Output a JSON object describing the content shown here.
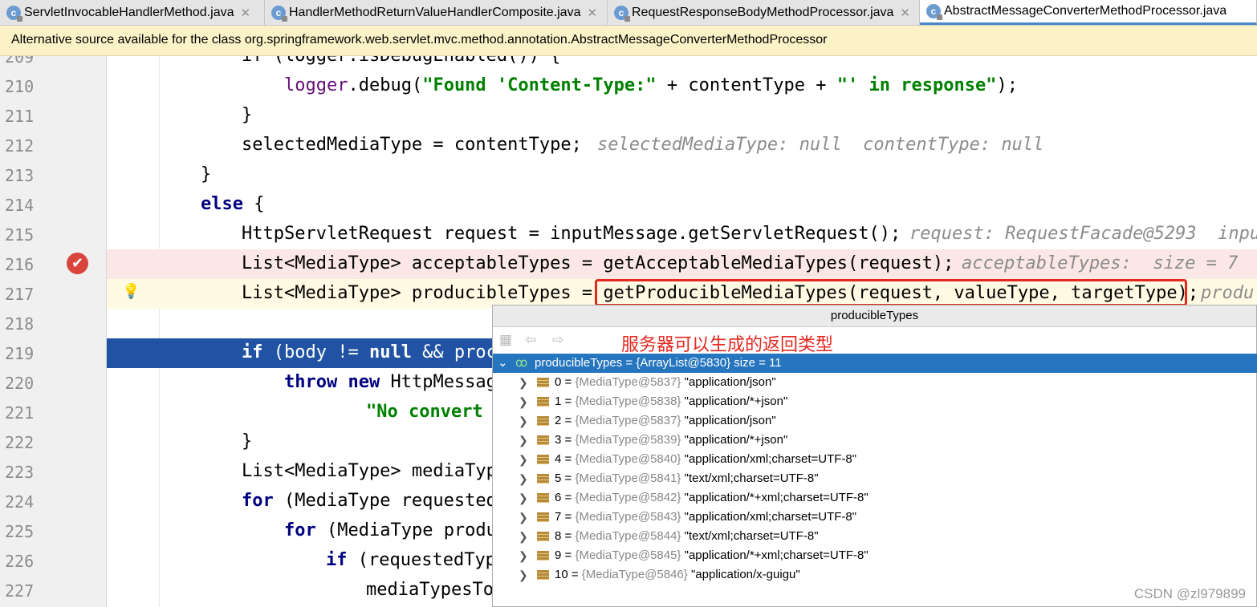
{
  "tabs": [
    {
      "label": "ServletInvocableHandlerMethod.java",
      "active": false
    },
    {
      "label": "HandlerMethodReturnValueHandlerComposite.java",
      "active": false
    },
    {
      "label": "RequestResponseBodyMethodProcessor.java",
      "active": false
    },
    {
      "label": "AbstractMessageConverterMethodProcessor.java",
      "active": true
    }
  ],
  "notice": "Alternative source available for the class org.springframework.web.servlet.mvc.method.annotation.AbstractMessageConverterMethodProcessor",
  "lines": {
    "l209": {
      "num": "209",
      "code": "if (logger.isDebugEnabled()) {"
    },
    "l210": {
      "num": "210",
      "call": "logger",
      "rest": ".debug(",
      "s1": "\"Found 'Content-Type:\"",
      "mid": " + contentType + ",
      "s2": "\"' in response\"",
      "end": ");"
    },
    "l211": {
      "num": "211",
      "code": "}"
    },
    "l212": {
      "num": "212",
      "code": "selectedMediaType = contentType;",
      "hint": "selectedMediaType: null  contentType: null"
    },
    "l213": {
      "num": "213",
      "code": "}"
    },
    "l214": {
      "num": "214",
      "kw": "else",
      "code": " {"
    },
    "l215": {
      "num": "215",
      "code": "HttpServletRequest request = inputMessage.getServletRequest();",
      "hint": "request: RequestFacade@5293  inpu"
    },
    "l216": {
      "num": "216",
      "code": "List<MediaType> acceptableTypes = getAcceptableMediaTypes(request);",
      "hint": "acceptableTypes:  size = 7"
    },
    "l217": {
      "num": "217",
      "code": "List<MediaType> producibleTypes = getProducibleMediaTypes(request, valueType, targetType);",
      "hint": "produ"
    },
    "l218": {
      "num": "218",
      "code": ""
    },
    "l219": {
      "num": "219",
      "kw": "if",
      "code": " (body != ",
      "kw2": "null",
      "code2": " && proc"
    },
    "l220": {
      "num": "220",
      "kw": "throw new",
      "code": " HttpMessag"
    },
    "l221": {
      "num": "221",
      "str": "\"No convert"
    },
    "l222": {
      "num": "222",
      "code": "}"
    },
    "l223": {
      "num": "223",
      "code": "List<MediaType> mediaTyp"
    },
    "l224": {
      "num": "224",
      "kw": "for",
      "code": " (MediaType requested"
    },
    "l225": {
      "num": "225",
      "kw": "for",
      "code": " (MediaType produ"
    },
    "l226": {
      "num": "226",
      "kw": "if",
      "code": " (requestedTyp"
    },
    "l227": {
      "num": "227",
      "code": "mediaTypesTo"
    }
  },
  "popup": {
    "title": "producibleTypes",
    "annotation": "服务器可以生成的返回类型",
    "root": {
      "name": "producibleTypes",
      "ref": " = {ArrayList@5830}",
      "size": "  size = 11"
    },
    "items": [
      {
        "idx": "0",
        "ref": "{MediaType@5837}",
        "val": "\"application/json\""
      },
      {
        "idx": "1",
        "ref": "{MediaType@5838}",
        "val": "\"application/*+json\""
      },
      {
        "idx": "2",
        "ref": "{MediaType@5837}",
        "val": "\"application/json\""
      },
      {
        "idx": "3",
        "ref": "{MediaType@5839}",
        "val": "\"application/*+json\""
      },
      {
        "idx": "4",
        "ref": "{MediaType@5840}",
        "val": "\"application/xml;charset=UTF-8\""
      },
      {
        "idx": "5",
        "ref": "{MediaType@5841}",
        "val": "\"text/xml;charset=UTF-8\""
      },
      {
        "idx": "6",
        "ref": "{MediaType@5842}",
        "val": "\"application/*+xml;charset=UTF-8\""
      },
      {
        "idx": "7",
        "ref": "{MediaType@5843}",
        "val": "\"application/xml;charset=UTF-8\""
      },
      {
        "idx": "8",
        "ref": "{MediaType@5844}",
        "val": "\"text/xml;charset=UTF-8\""
      },
      {
        "idx": "9",
        "ref": "{MediaType@5845}",
        "val": "\"application/*+xml;charset=UTF-8\""
      },
      {
        "idx": "10",
        "ref": "{MediaType@5846}",
        "val": "\"application/x-guigu\""
      }
    ]
  },
  "watermark": "CSDN @zl979899",
  "icons": {
    "tab": "class-c-icon",
    "breakpoint": "breakpoint-check-icon",
    "bulb": "lightbulb-icon",
    "field": "field-icon"
  },
  "colors": {
    "highlight_box": "#e3281f",
    "selection": "#2152a3",
    "tree_selection": "#2675bf",
    "notice_bg": "#fbf3c7"
  }
}
